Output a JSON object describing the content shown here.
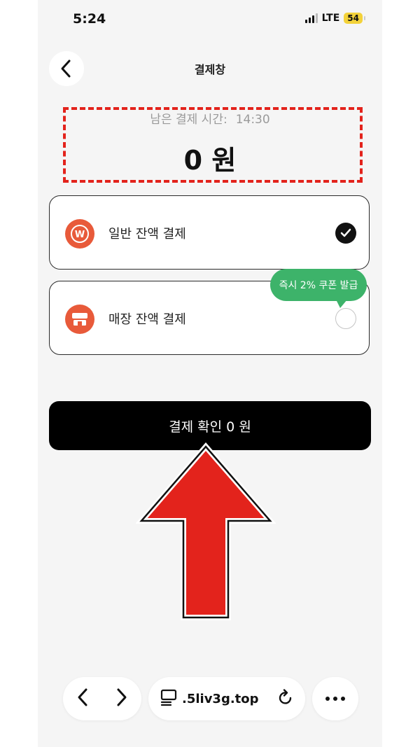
{
  "status_bar": {
    "time": "5:24",
    "network": "LTE",
    "battery": "54"
  },
  "header": {
    "title": "결제창"
  },
  "payment_timer": {
    "label": "남은 결제 시간:",
    "value": "14:30"
  },
  "amount": {
    "text": "0 원"
  },
  "options": [
    {
      "label": "일반 잔액 결제",
      "selected": true,
      "icon": "w-coin-icon"
    },
    {
      "label": "매장 잔액 결제",
      "selected": false,
      "icon": "store-icon"
    }
  ],
  "coupon_tooltip": {
    "text": "즉시 2% 쿠폰 발급"
  },
  "confirm_button": {
    "label": "결제 확인 0 원"
  },
  "browser_bar": {
    "url": ".5liv3g.top"
  },
  "colors": {
    "accent_red": "#e3231c",
    "coupon_green": "#3db36a",
    "icon_orange": "#e85a3a",
    "button_black": "#000000"
  }
}
